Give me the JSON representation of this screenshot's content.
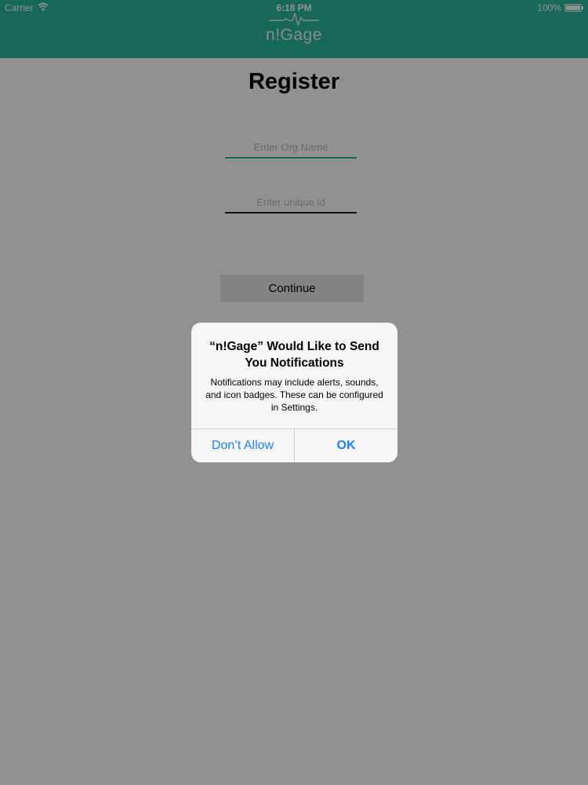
{
  "status_bar": {
    "carrier": "Carrier",
    "time": "6:18 PM",
    "battery": "100%"
  },
  "header": {
    "app_name": "n!Gage",
    "brand_color": "#2bb89f"
  },
  "register": {
    "title": "Register",
    "org_name_placeholder": "Enter Org Name",
    "unique_id_placeholder": "Enter unique id",
    "continue_label": "Continue"
  },
  "alert": {
    "title": "“n!Gage” Would Like to Send You Notifications",
    "message": "Notifications may include alerts, sounds, and icon badges. These can be configured in Settings.",
    "dont_allow_label": "Don’t Allow",
    "ok_label": "OK",
    "button_color": "#1a82fb"
  },
  "icons": {
    "wifi": "wifi-icon",
    "battery": "battery-icon",
    "logo": "heartbeat-pulse-icon"
  }
}
